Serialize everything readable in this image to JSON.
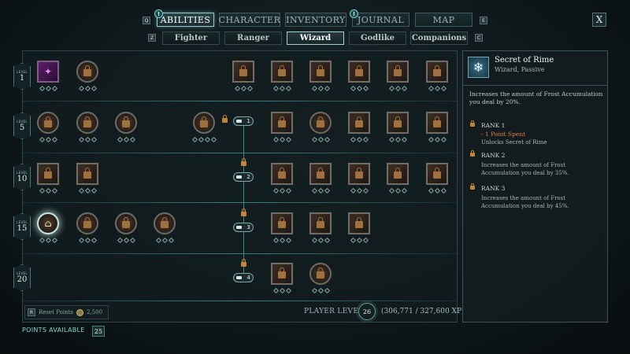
{
  "nav": {
    "tabs": [
      {
        "label": "ABILITIES",
        "active": true,
        "alert": "!"
      },
      {
        "label": "CHARACTER",
        "active": false
      },
      {
        "label": "INVENTORY",
        "active": false
      },
      {
        "label": "JOURNAL",
        "active": false,
        "alert": "!"
      },
      {
        "label": "MAP",
        "active": false
      }
    ],
    "keys": {
      "left_top": "Q",
      "right_top": "E",
      "left_sub": "Z",
      "right_sub": "C"
    },
    "close_label": "X",
    "subtabs": [
      {
        "label": "Fighter",
        "active": false
      },
      {
        "label": "Ranger",
        "active": false
      },
      {
        "label": "Wizard",
        "active": true
      },
      {
        "label": "Godlike",
        "active": false
      },
      {
        "label": "Companions",
        "active": false
      }
    ]
  },
  "tree": {
    "levels": [
      {
        "word": "LEVEL",
        "num": "1"
      },
      {
        "word": "LEVEL",
        "num": "5"
      },
      {
        "word": "LEVEL",
        "num": "10"
      },
      {
        "word": "LEVEL",
        "num": "15"
      },
      {
        "word": "LEVEL",
        "num": "20"
      }
    ],
    "tiers": [
      "1",
      "2",
      "3",
      "4"
    ]
  },
  "footer": {
    "reset_key": "R",
    "reset_label": "Reset Points",
    "reset_cost": "2,500",
    "player_level_label": "PLAYER LEVEL",
    "player_level": "26",
    "xp": "(306,771 / 327,600 XP)",
    "points_label": "POINTS AVAILABLE",
    "points_value": "25"
  },
  "detail": {
    "title": "Secret of Rime",
    "subtitle": "Wizard, Passive",
    "description": "Increases the amount of Frost Accumulation you deal by 20%.",
    "ranks": [
      {
        "title": "RANK 1",
        "spent": "- 1 Point Spent",
        "desc": "Unlocks Secret of Rime"
      },
      {
        "title": "RANK 2",
        "desc": "Increases the amount of Frost Accumulation you deal by 35%."
      },
      {
        "title": "RANK 3",
        "desc": "Increases the amount of Frost Accumulation you deal by 45%."
      }
    ]
  },
  "colors": {
    "accent": "#7fd7d2",
    "spent": "#e07b3c",
    "lock": "#c38438"
  }
}
